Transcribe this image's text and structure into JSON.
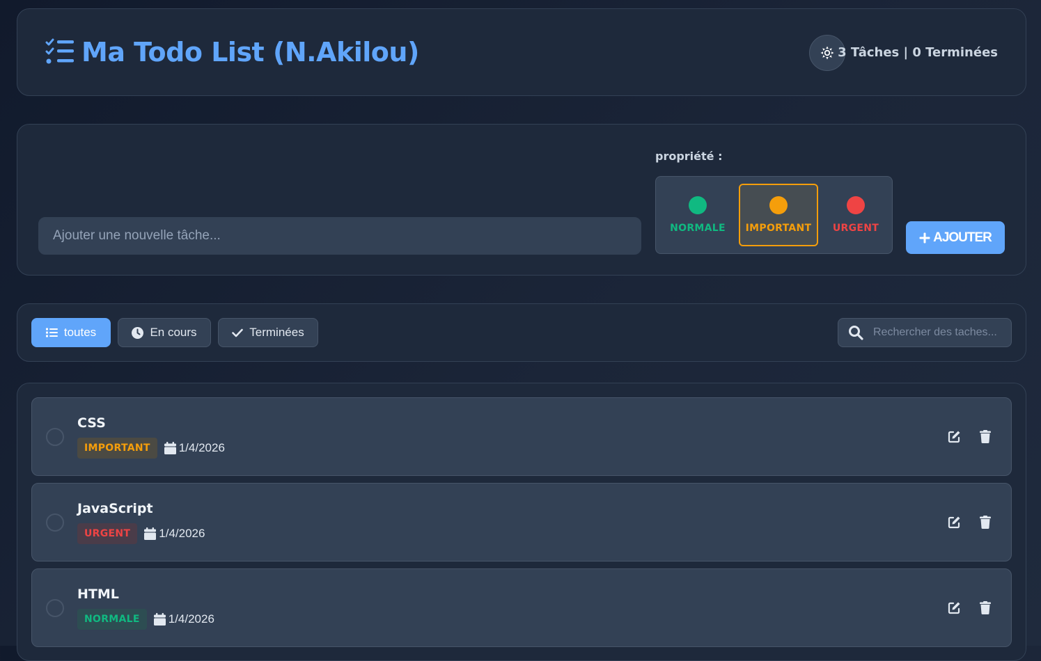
{
  "header": {
    "title": "Ma Todo List (N.Akilou)",
    "stats": "3 Tâches | 0 Terminées"
  },
  "add_task": {
    "placeholder": "Ajouter une nouvelle tâche...",
    "priority_label": "propriété :",
    "priorities": [
      {
        "label": "NORMALE",
        "color": "#10b981",
        "selected": false
      },
      {
        "label": "IMPORTANT",
        "color": "#f59e0b",
        "selected": true
      },
      {
        "label": "URGENT",
        "color": "#ef4444",
        "selected": false
      }
    ],
    "add_button": "AJOUTER"
  },
  "filters": {
    "all": "toutes",
    "in_progress": "En cours",
    "done": "Terminées",
    "active": "toutes",
    "search_placeholder": "Rechercher des taches..."
  },
  "tasks": [
    {
      "title": "CSS",
      "priority": "IMPORTANT",
      "date": "1/4/2026",
      "completed": false
    },
    {
      "title": "JavaScript",
      "priority": "URGENT",
      "date": "1/4/2026",
      "completed": false
    },
    {
      "title": "HTML",
      "priority": "NORMALE",
      "date": "1/4/2026",
      "completed": false
    }
  ],
  "colors": {
    "accent": "#60a5fa",
    "normale": "#10b981",
    "important": "#f59e0b",
    "urgent": "#ef4444"
  }
}
